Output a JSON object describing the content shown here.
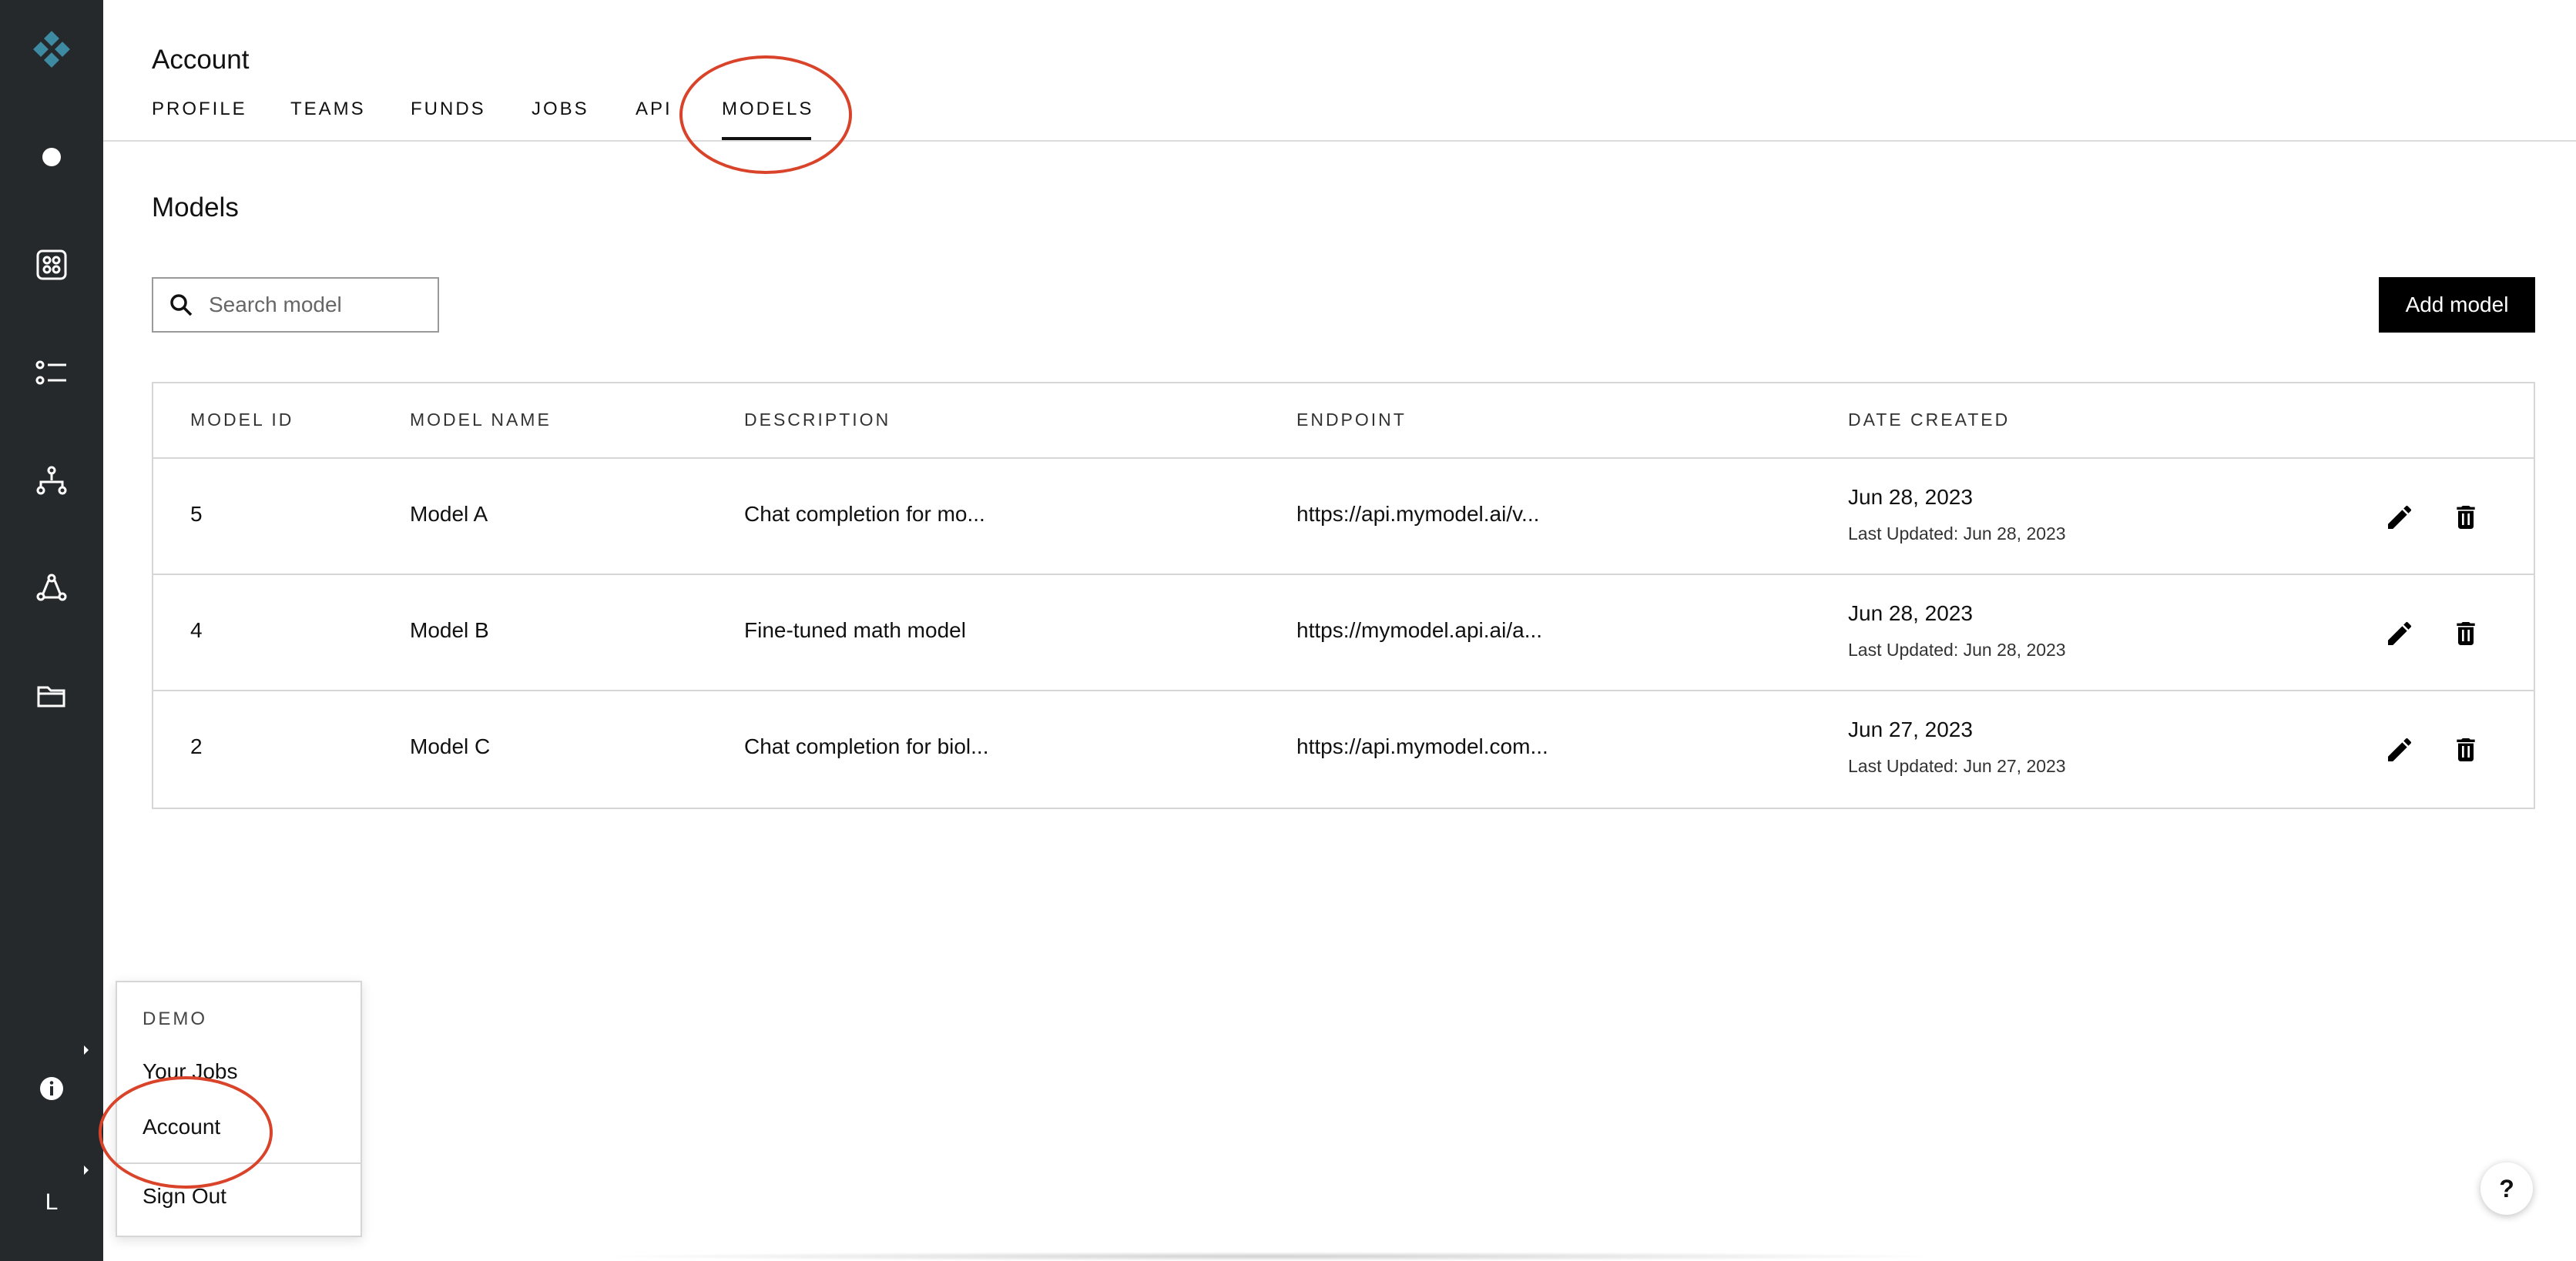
{
  "sidebar": {
    "logo_icon": "diamond-logo-icon",
    "icons": [
      "dot-icon",
      "command-grid-icon",
      "checklist-icon",
      "hierarchy-icon",
      "network-icon",
      "folder-icon",
      "info-icon"
    ],
    "avatar_letter": "L"
  },
  "header": {
    "title": "Account",
    "tabs": [
      {
        "label": "PROFILE"
      },
      {
        "label": "TEAMS"
      },
      {
        "label": "FUNDS"
      },
      {
        "label": "JOBS"
      },
      {
        "label": "API"
      },
      {
        "label": "MODELS",
        "active": true
      }
    ]
  },
  "main": {
    "section_title": "Models",
    "search": {
      "placeholder": "Search model",
      "value": ""
    },
    "add_button_label": "Add model",
    "table": {
      "columns": [
        "MODEL ID",
        "MODEL NAME",
        "DESCRIPTION",
        "ENDPOINT",
        "DATE CREATED"
      ],
      "rows": [
        {
          "id": "5",
          "name": "Model A",
          "description": "Chat completion for mo...",
          "endpoint": "https://api.mymodel.ai/v...",
          "date_created": "Jun 28, 2023",
          "last_updated": "Last Updated: Jun 28, 2023"
        },
        {
          "id": "4",
          "name": "Model B",
          "description": "Fine-tuned math model",
          "endpoint": "https://mymodel.api.ai/a...",
          "date_created": "Jun 28, 2023",
          "last_updated": "Last Updated: Jun 28, 2023"
        },
        {
          "id": "2",
          "name": "Model C",
          "description": "Chat completion for biol...",
          "endpoint": "https://api.mymodel.com...",
          "date_created": "Jun 27, 2023",
          "last_updated": "Last Updated: Jun 27, 2023"
        }
      ],
      "row_actions": [
        "pencil-icon",
        "trash-icon"
      ]
    }
  },
  "user_menu": {
    "label": "DEMO",
    "items": [
      "Your Jobs",
      "Account",
      "Sign Out"
    ]
  },
  "help_button_label": "?",
  "colors": {
    "sidebar_bg": "#26292c",
    "logo_accent": "#3d8ba3",
    "annotation": "#d9432a",
    "primary_button": "#000000"
  }
}
